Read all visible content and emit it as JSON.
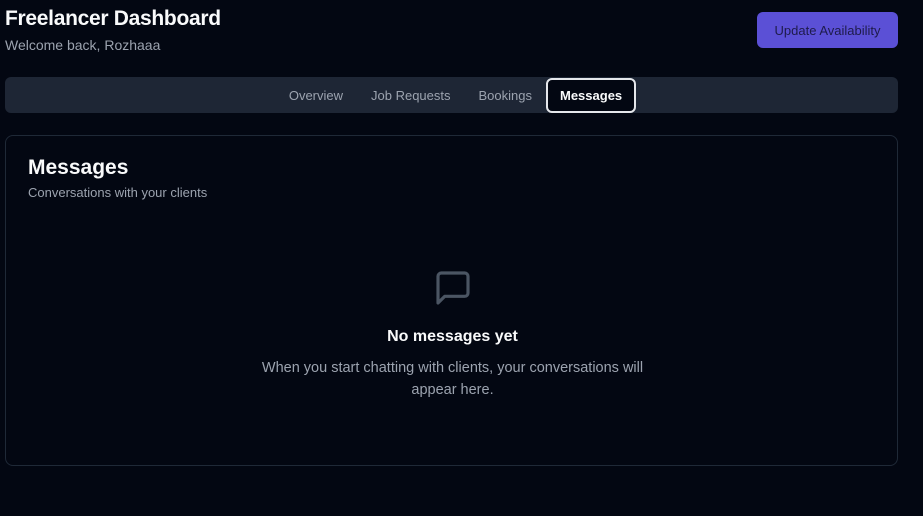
{
  "header": {
    "title": "Freelancer Dashboard",
    "welcome": "Welcome back, Rozhaaa"
  },
  "actions": {
    "update_availability_label": "Update Availability"
  },
  "tabs": [
    {
      "label": "Overview",
      "active": false
    },
    {
      "label": "Job Requests",
      "active": false
    },
    {
      "label": "Bookings",
      "active": false
    },
    {
      "label": "Messages",
      "active": true
    }
  ],
  "messages_card": {
    "title": "Messages",
    "description": "Conversations with your clients",
    "empty_state": {
      "icon": "message-square-icon",
      "title": "No messages yet",
      "text": "When you start chatting with clients, your conversations will appear here."
    }
  },
  "colors": {
    "background": "#030712",
    "accent": "#5b50d6",
    "tab_bar": "#1e2635",
    "muted_text": "#9ca3af"
  }
}
